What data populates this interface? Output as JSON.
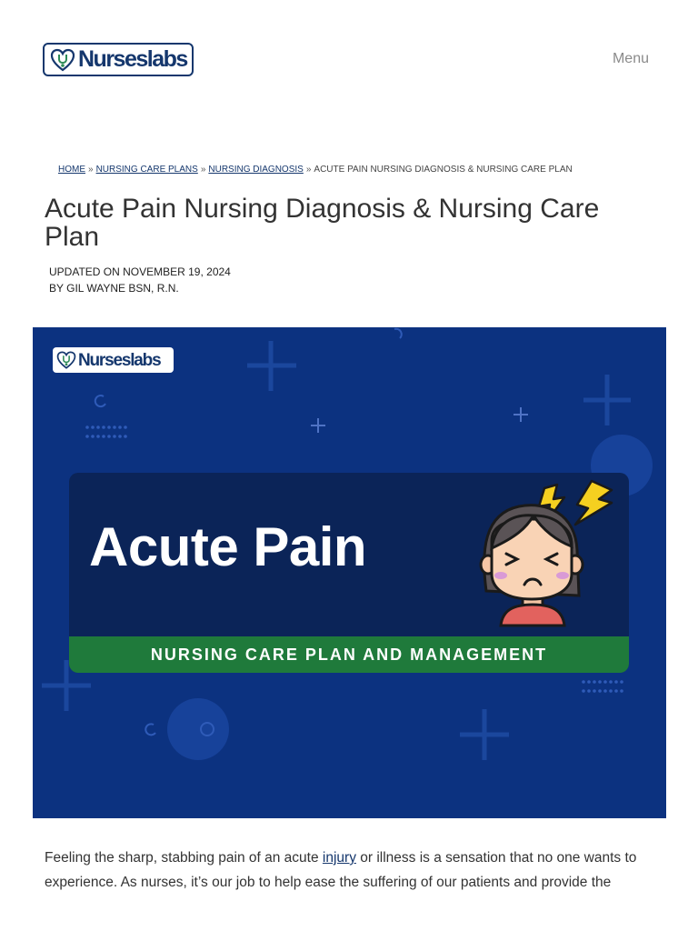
{
  "header": {
    "logo_text": "Nurseslabs",
    "menu_label": "Menu"
  },
  "breadcrumb": {
    "items": [
      "HOME",
      "NURSING CARE PLANS",
      "NURSING DIAGNOSIS"
    ],
    "separator": "»",
    "current": "ACUTE PAIN NURSING DIAGNOSIS & NURSING CARE PLAN"
  },
  "article": {
    "title": "Acute Pain Nursing Diagnosis & Nursing Care Plan",
    "updated": "UPDATED ON NOVEMBER 19, 2024",
    "byline": "BY GIL WAYNE BSN, R.N.",
    "intro_before_link": "Feeling the sharp, stabbing pain of an acute ",
    "intro_link": "injury",
    "intro_after_link": " or illness is a sensation that no one wants to experience. As nurses, it’s our job to help ease the suffering of our patients and provide the"
  },
  "hero": {
    "logo_text": "Nurseslabs",
    "heading": "Acute Pain",
    "banner": "NURSING CARE PLAN AND MANAGEMENT"
  },
  "colors": {
    "brand_navy": "#15376d",
    "hero_bg": "#0c3280",
    "hero_card": "#0b2458",
    "banner_green": "#1f7a3b",
    "lightning_yellow": "#f5d020"
  },
  "icons": {
    "logo": "heart-stethoscope-icon",
    "character": "girl-headache-icon"
  }
}
